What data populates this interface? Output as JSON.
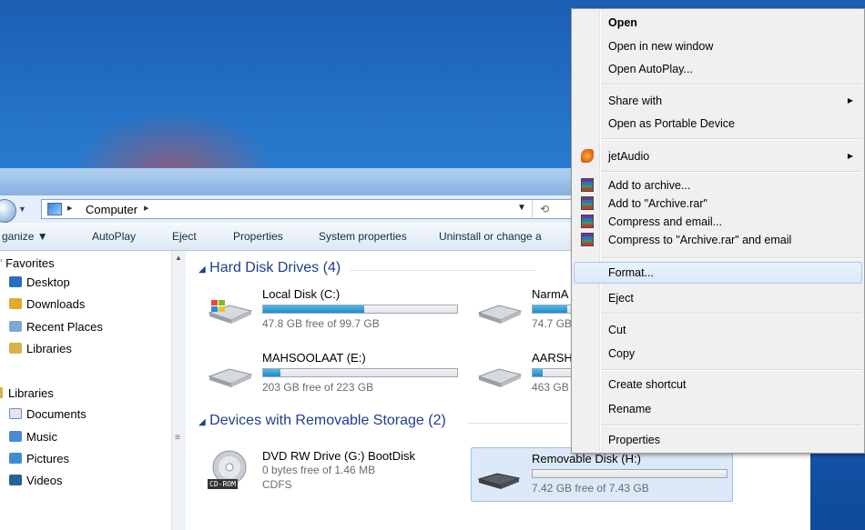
{
  "window": {
    "breadcrumb": "Computer",
    "toolbar": [
      "ganize ▼",
      "AutoPlay",
      "Eject",
      "Properties",
      "System properties",
      "Uninstall or change a"
    ]
  },
  "sidebar": {
    "favorites_header": "Favorites",
    "favorites": [
      "Desktop",
      "Downloads",
      "Recent Places",
      "Libraries"
    ],
    "libraries_header": "Libraries",
    "libraries": [
      "Documents",
      "Music",
      "Pictures",
      "Videos"
    ]
  },
  "main": {
    "hard_disk_header": "Hard Disk Drives (4)",
    "removable_header": "Devices with Removable Storage (2)",
    "drives": [
      {
        "name": "Local Disk (C:)",
        "free": "47.8 GB free of 99.7 GB",
        "used_fraction": 0.52
      },
      {
        "name": "NarmA",
        "free": "74.7 GB",
        "used_fraction": 0.5
      },
      {
        "name": "MAHSOOLAAT (E:)",
        "free": "203 GB free of 223 GB",
        "used_fraction": 0.09
      },
      {
        "name": "AARSH",
        "free": "463 GB",
        "used_fraction": 0.1
      },
      {
        "name": "DVD RW Drive (G:) BootDisk",
        "free": "0 bytes free of 1.46 MB",
        "fs": "CDFS",
        "badge": "CD-ROM"
      },
      {
        "name": "Removable Disk (H:)",
        "free": "7.42 GB free of 7.43 GB",
        "used_fraction": 0.0
      }
    ]
  },
  "context_menu": {
    "items": [
      {
        "label": "Open",
        "bold": true
      },
      {
        "label": "Open in new window"
      },
      {
        "label": "Open AutoPlay..."
      },
      {
        "label": "Share with",
        "submenu": true
      },
      {
        "label": "Open as Portable Device"
      },
      {
        "label": "jetAudio",
        "submenu": true,
        "icon": "jetaudio-icon"
      },
      {
        "label": "Add to archive...",
        "icon": "winrar-icon"
      },
      {
        "label": "Add to \"Archive.rar\"",
        "icon": "winrar-icon"
      },
      {
        "label": "Compress and email...",
        "icon": "winrar-icon"
      },
      {
        "label": "Compress to \"Archive.rar\" and email",
        "icon": "winrar-icon"
      },
      {
        "label": "Format...",
        "highlighted": true
      },
      {
        "label": "Eject"
      },
      {
        "label": "Cut"
      },
      {
        "label": "Copy"
      },
      {
        "label": "Create shortcut"
      },
      {
        "label": "Rename"
      },
      {
        "label": "Properties"
      }
    ]
  },
  "colors": {
    "desktop": "#2a7fd2",
    "menu_bg": "#f0f0f0",
    "menu_highlight": "#dbe8fa",
    "group_header": "#1e3e8c",
    "drive_bar": "#1b8ac6"
  }
}
